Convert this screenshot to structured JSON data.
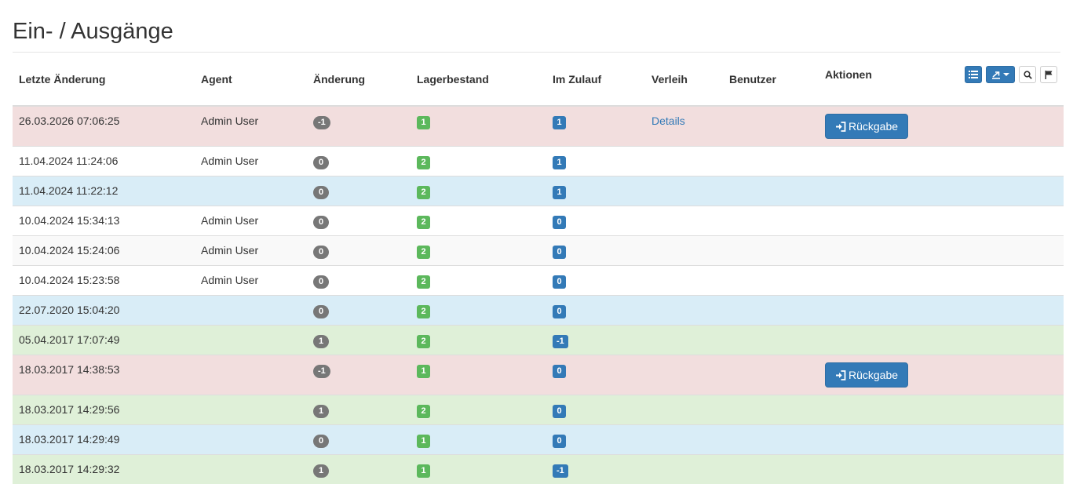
{
  "page_title": "Ein- / Ausgänge",
  "table": {
    "headers": {
      "last_change": "Letzte Änderung",
      "agent": "Agent",
      "change": "Änderung",
      "stock": "Lagerbestand",
      "incoming": "Im Zulauf",
      "loan": "Verleih",
      "user": "Benutzer",
      "actions": "Aktionen"
    },
    "return_button_label": "Rückgabe",
    "details_link_label": "Details",
    "rows": [
      {
        "date": "26.03.2026 07:06:25",
        "agent": "Admin User",
        "change": "-1",
        "stock": "1",
        "incoming": "1",
        "loan": "Details",
        "user": "",
        "action": "Rückgabe",
        "style": "danger"
      },
      {
        "date": "11.04.2024 11:24:06",
        "agent": "Admin User",
        "change": "0",
        "stock": "2",
        "incoming": "1",
        "loan": "",
        "user": "",
        "action": "",
        "style": "plain"
      },
      {
        "date": "11.04.2024 11:22:12",
        "agent": "",
        "change": "0",
        "stock": "2",
        "incoming": "1",
        "loan": "",
        "user": "",
        "action": "",
        "style": "info"
      },
      {
        "date": "10.04.2024 15:34:13",
        "agent": "Admin User",
        "change": "0",
        "stock": "2",
        "incoming": "0",
        "loan": "",
        "user": "",
        "action": "",
        "style": "plain"
      },
      {
        "date": "10.04.2024 15:24:06",
        "agent": "Admin User",
        "change": "0",
        "stock": "2",
        "incoming": "0",
        "loan": "",
        "user": "",
        "action": "",
        "style": "alt"
      },
      {
        "date": "10.04.2024 15:23:58",
        "agent": "Admin User",
        "change": "0",
        "stock": "2",
        "incoming": "0",
        "loan": "",
        "user": "",
        "action": "",
        "style": "plain"
      },
      {
        "date": "22.07.2020 15:04:20",
        "agent": "",
        "change": "0",
        "stock": "2",
        "incoming": "0",
        "loan": "",
        "user": "",
        "action": "",
        "style": "info"
      },
      {
        "date": "05.04.2017 17:07:49",
        "agent": "",
        "change": "1",
        "stock": "2",
        "incoming": "-1",
        "loan": "",
        "user": "",
        "action": "",
        "style": "success"
      },
      {
        "date": "18.03.2017 14:38:53",
        "agent": "",
        "change": "-1",
        "stock": "1",
        "incoming": "0",
        "loan": "",
        "user": "",
        "action": "Rückgabe",
        "style": "danger"
      },
      {
        "date": "18.03.2017 14:29:56",
        "agent": "",
        "change": "1",
        "stock": "2",
        "incoming": "0",
        "loan": "",
        "user": "",
        "action": "",
        "style": "success"
      },
      {
        "date": "18.03.2017 14:29:49",
        "agent": "",
        "change": "0",
        "stock": "1",
        "incoming": "0",
        "loan": "",
        "user": "",
        "action": "",
        "style": "info"
      },
      {
        "date": "18.03.2017 14:29:32",
        "agent": "",
        "change": "1",
        "stock": "1",
        "incoming": "-1",
        "loan": "",
        "user": "",
        "action": "",
        "style": "success"
      }
    ]
  },
  "toolbar": {
    "buttons": [
      {
        "icon": "list-icon",
        "style": "blue"
      },
      {
        "icon": "export-icon",
        "style": "blue",
        "dropdown": true
      },
      {
        "icon": "search-icon",
        "style": "white"
      },
      {
        "icon": "flag-icon",
        "style": "white"
      }
    ]
  },
  "colors": {
    "danger_row": "#f2dede",
    "info_row": "#d9edf7",
    "success_row": "#dff0d8",
    "primary": "#337ab7",
    "success_label": "#5cb85c",
    "badge_gray": "#777777"
  }
}
